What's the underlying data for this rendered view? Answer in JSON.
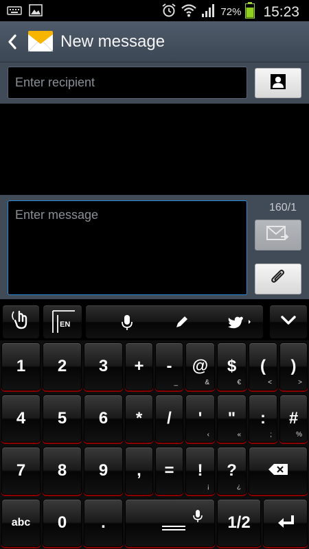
{
  "status_bar": {
    "battery_percent": "72%",
    "time": "15:23",
    "icons": [
      "keyboard-icon",
      "image-icon",
      "alarm-icon",
      "wifi-icon",
      "signal-icon",
      "battery-icon"
    ]
  },
  "header": {
    "title": "New message",
    "back_icon": "chevron-left-icon",
    "app_icon": "envelope-icon",
    "accent": "#45515f"
  },
  "recipient": {
    "placeholder": "Enter recipient",
    "contact_icon": "contact-icon"
  },
  "compose": {
    "placeholder": "Enter message",
    "counter": "160/1",
    "send_icon": "send-icon",
    "attach_icon": "paperclip-icon",
    "focus_color": "#2b8ad6"
  },
  "keyboard": {
    "toolbar": {
      "layout_label": "EN",
      "icons": [
        "gesture-icon",
        "language-icon",
        "microphone-icon",
        "pencil-icon",
        "twitter-icon",
        "chevron-down-icon"
      ]
    },
    "rows": [
      [
        {
          "main": "1"
        },
        {
          "main": "2"
        },
        {
          "main": "3"
        },
        {
          "main": "+"
        },
        {
          "main": "-",
          "sub": "_"
        },
        {
          "main": "@",
          "sub": "&"
        },
        {
          "main": "$",
          "sub": "€"
        },
        {
          "main": "(",
          "sub": "<"
        },
        {
          "main": ")",
          "sub": ">"
        }
      ],
      [
        {
          "main": "4"
        },
        {
          "main": "5"
        },
        {
          "main": "6"
        },
        {
          "main": "*"
        },
        {
          "main": "/"
        },
        {
          "main": "'",
          "sub": "‹"
        },
        {
          "main": "\"",
          "sub": "«"
        },
        {
          "main": ":",
          "sub": ";"
        },
        {
          "main": "#",
          "sub": "%"
        }
      ],
      [
        {
          "main": "7"
        },
        {
          "main": "8"
        },
        {
          "main": "9"
        },
        {
          "main": ","
        },
        {
          "main": "="
        },
        {
          "main": "!",
          "sub": "¡"
        },
        {
          "main": "?",
          "sub": "¿"
        }
      ],
      [
        {
          "main": "abc"
        },
        {
          "main": "0"
        },
        {
          "main": "."
        },
        {
          "main": "1/2"
        }
      ]
    ],
    "key_outline_color": "#8a0000"
  }
}
